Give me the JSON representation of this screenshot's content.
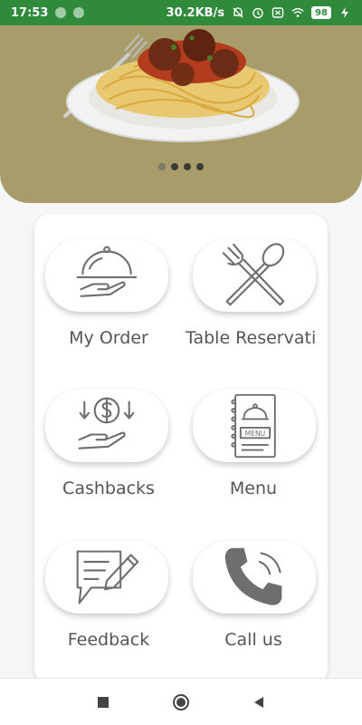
{
  "status_bar": {
    "time": "17:53",
    "network_speed": "30.2KB/s",
    "battery_level": "98"
  },
  "hero": {
    "image_icon": "spaghetti-plate-image",
    "pager_count": 4,
    "active_page": 1
  },
  "tiles": [
    {
      "label": "My Order",
      "icon": "cloche-hand-icon"
    },
    {
      "label": "Table Reservatio",
      "icon": "fork-spoon-icon"
    },
    {
      "label": "Cashbacks",
      "icon": "coin-hand-icon"
    },
    {
      "label": "Menu",
      "icon": "menu-book-icon"
    },
    {
      "label": "Feedback",
      "icon": "feedback-pen-icon"
    },
    {
      "label": "Call us",
      "icon": "phone-icon"
    }
  ],
  "nav": {
    "recents_icon": "square-icon",
    "home_icon": "circle-home-icon",
    "back_icon": "triangle-back-icon"
  },
  "colors": {
    "status_bar": "#2f8a3c",
    "hero_bg": "#a89d6a",
    "icon_stroke": "#6e6e6e"
  }
}
